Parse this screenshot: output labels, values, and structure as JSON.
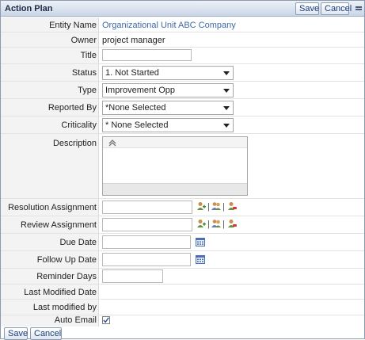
{
  "header": {
    "title": "Action Plan",
    "save_label": "Save",
    "cancel_label": "Cancel"
  },
  "fields": {
    "entity_name": {
      "label": "Entity Name",
      "value": "Organizational Unit ABC Company"
    },
    "owner": {
      "label": "Owner",
      "value": "project manager"
    },
    "title": {
      "label": "Title",
      "value": ""
    },
    "status": {
      "label": "Status",
      "selected": "1. Not Started"
    },
    "type": {
      "label": "Type",
      "selected": "Improvement Opp"
    },
    "reported_by": {
      "label": "Reported By",
      "selected": "*None Selected"
    },
    "criticality": {
      "label": "Criticality",
      "selected": "* None Selected"
    },
    "description": {
      "label": "Description",
      "value": ""
    },
    "resolution_assignment": {
      "label": "Resolution Assignment",
      "value": ""
    },
    "review_assignment": {
      "label": "Review Assignment",
      "value": ""
    },
    "due_date": {
      "label": "Due Date",
      "value": ""
    },
    "follow_up_date": {
      "label": "Follow Up Date",
      "value": ""
    },
    "reminder_days": {
      "label": "Reminder Days",
      "value": ""
    },
    "last_modified_date": {
      "label": "Last Modified Date",
      "value": ""
    },
    "last_modified_by": {
      "label": "Last modified by",
      "value": ""
    },
    "auto_email": {
      "label": "Auto Email",
      "checked": true
    }
  },
  "footer": {
    "save_label": "Save",
    "cancel_label": "Cancel"
  },
  "icons": {
    "add_user": "add-user-icon",
    "select_users": "select-users-icon",
    "remove_user": "remove-user-icon",
    "calendar": "calendar-icon",
    "collapse": "collapse-icon"
  },
  "colors": {
    "link": "#3d6aa4",
    "header_bg": "#c9d5e6",
    "label_bg": "#f3f3f3"
  }
}
